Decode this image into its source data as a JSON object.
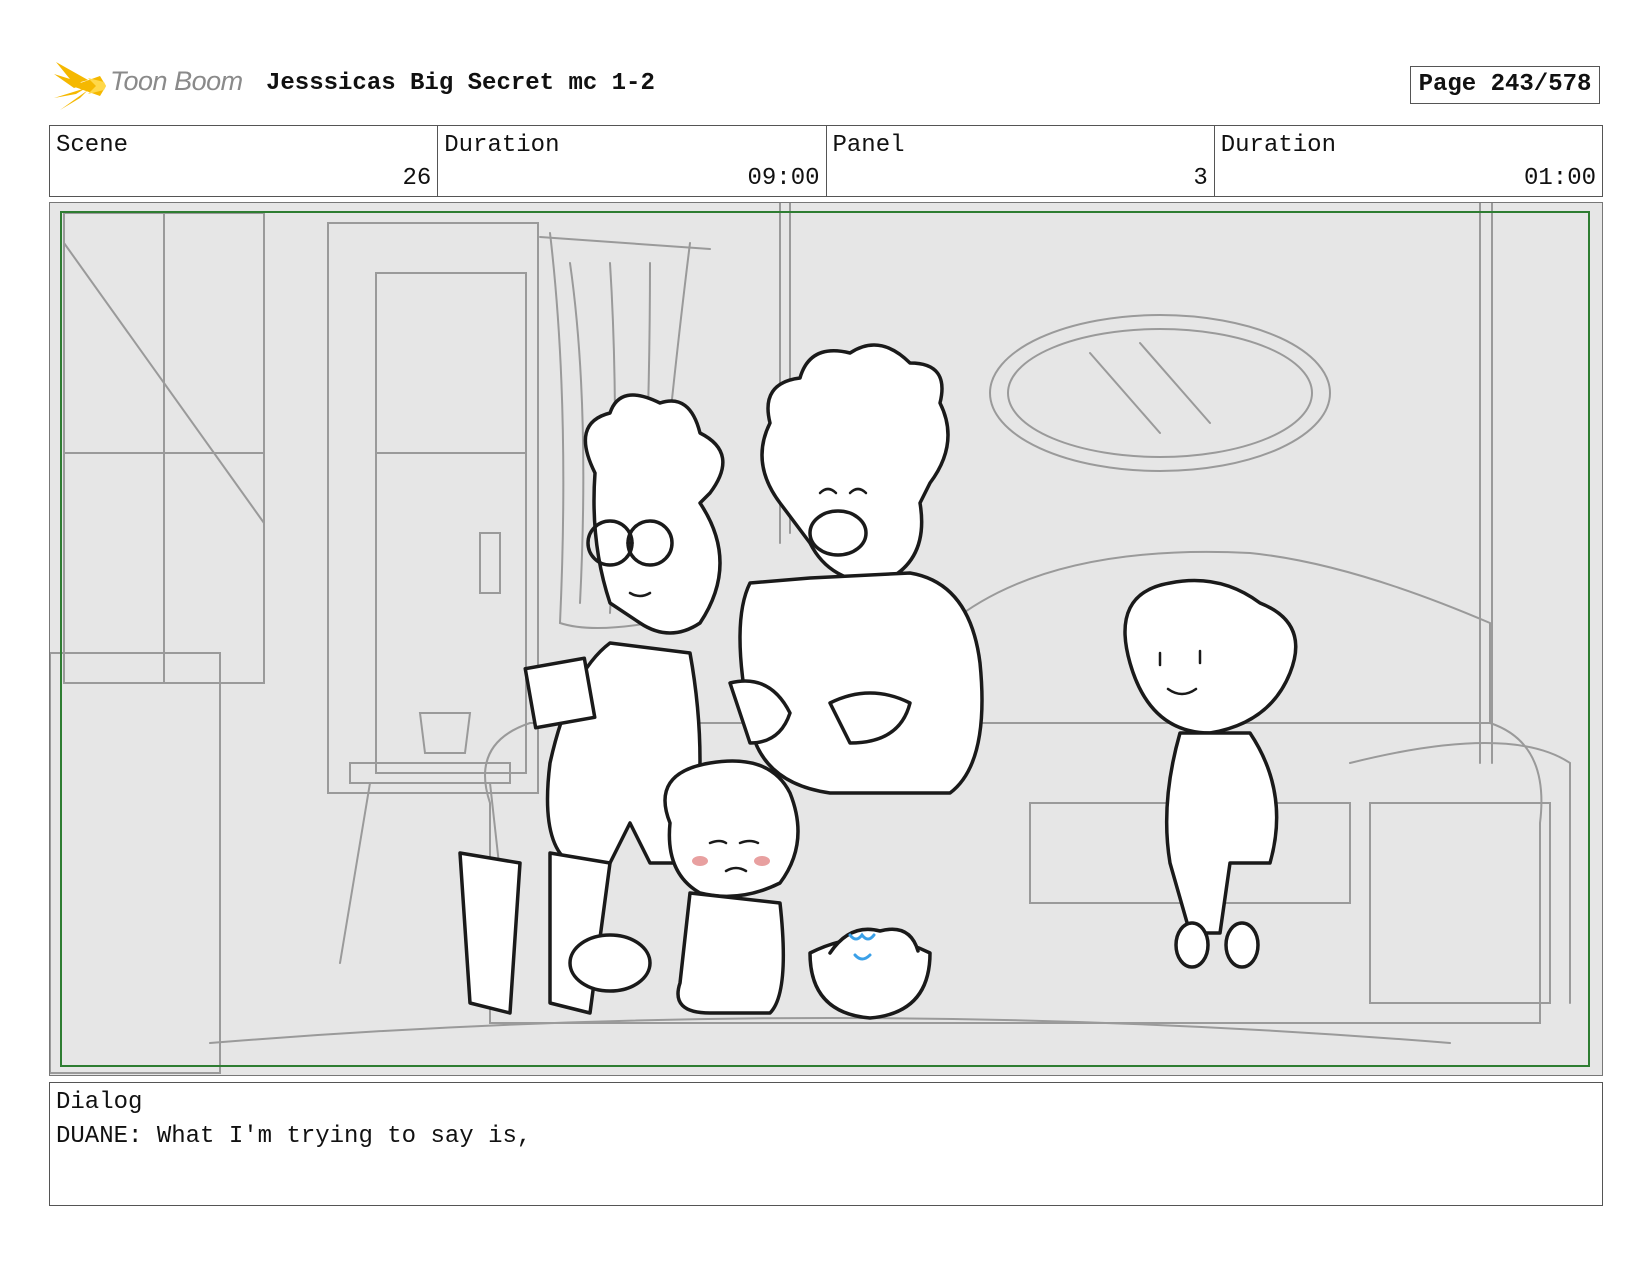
{
  "header": {
    "logo_text": "Toon Boom",
    "title": "Jesssicas Big Secret mc 1-2",
    "page": "Page 243/578"
  },
  "info": {
    "scene_label": "Scene",
    "scene_value": "26",
    "duration_label": "Duration",
    "duration_value": "09:00",
    "panel_label": "Panel",
    "panel_value": "3",
    "panel_duration_label": "Duration",
    "panel_duration_value": "01:00"
  },
  "panel": {
    "icon": "storyboard-sketch"
  },
  "dialog": {
    "label": "Dialog",
    "text": "DUANE: What I'm trying to say is,"
  },
  "colors": {
    "safe_frame": "#2e7d32",
    "logo_flare": "#f5b800",
    "blush": "#e8a0a0",
    "popcorn_accent": "#3aa0e8"
  }
}
